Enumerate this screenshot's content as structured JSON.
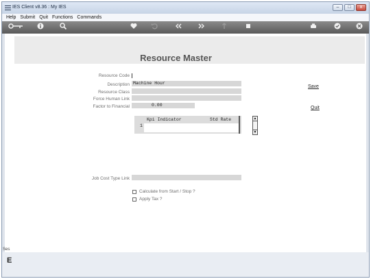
{
  "window": {
    "title": "IES Client v8.36 : My IES",
    "minimize_glyph": "–",
    "maximize_glyph": "□",
    "close_glyph": "x"
  },
  "menu": [
    "Help",
    "Submit",
    "Quit",
    "Functions",
    "Commands"
  ],
  "toolbar": {
    "icons": [
      "key-icon",
      "info-icon",
      "search-icon",
      "heart-icon",
      "undo-icon",
      "rewind-icon",
      "fast-forward-icon",
      "upload-icon",
      "stop-icon",
      "print-icon",
      "check-icon",
      "close-icon"
    ]
  },
  "page": {
    "title": "Resource Master"
  },
  "form": {
    "resource_code": {
      "label": "Resource Code",
      "value": ""
    },
    "description": {
      "label": "Description",
      "value": "Machine Hour"
    },
    "resource_class": {
      "label": "Resource Class",
      "value": ""
    },
    "force_human_link": {
      "label": "Force Human Link",
      "value": ""
    },
    "factor_to_financial": {
      "label": "Factor to Financial",
      "value": "0.00"
    },
    "job_cost_type_link": {
      "label": "Job Cost Type Link",
      "value": ""
    }
  },
  "actions": {
    "save": "Save",
    "quit": "Quit"
  },
  "grid": {
    "headers": [
      "Kpi Indicator",
      "Std Rate"
    ],
    "row_number": "1"
  },
  "checkboxes": {
    "calc_start_stop": {
      "label": "Calculate from Start / Stop ?",
      "checked": false
    },
    "apply_tax": {
      "label": "Apply Tax ?",
      "checked": false
    }
  },
  "side": {
    "edge_text": "Ses",
    "edge_letter": "E"
  }
}
